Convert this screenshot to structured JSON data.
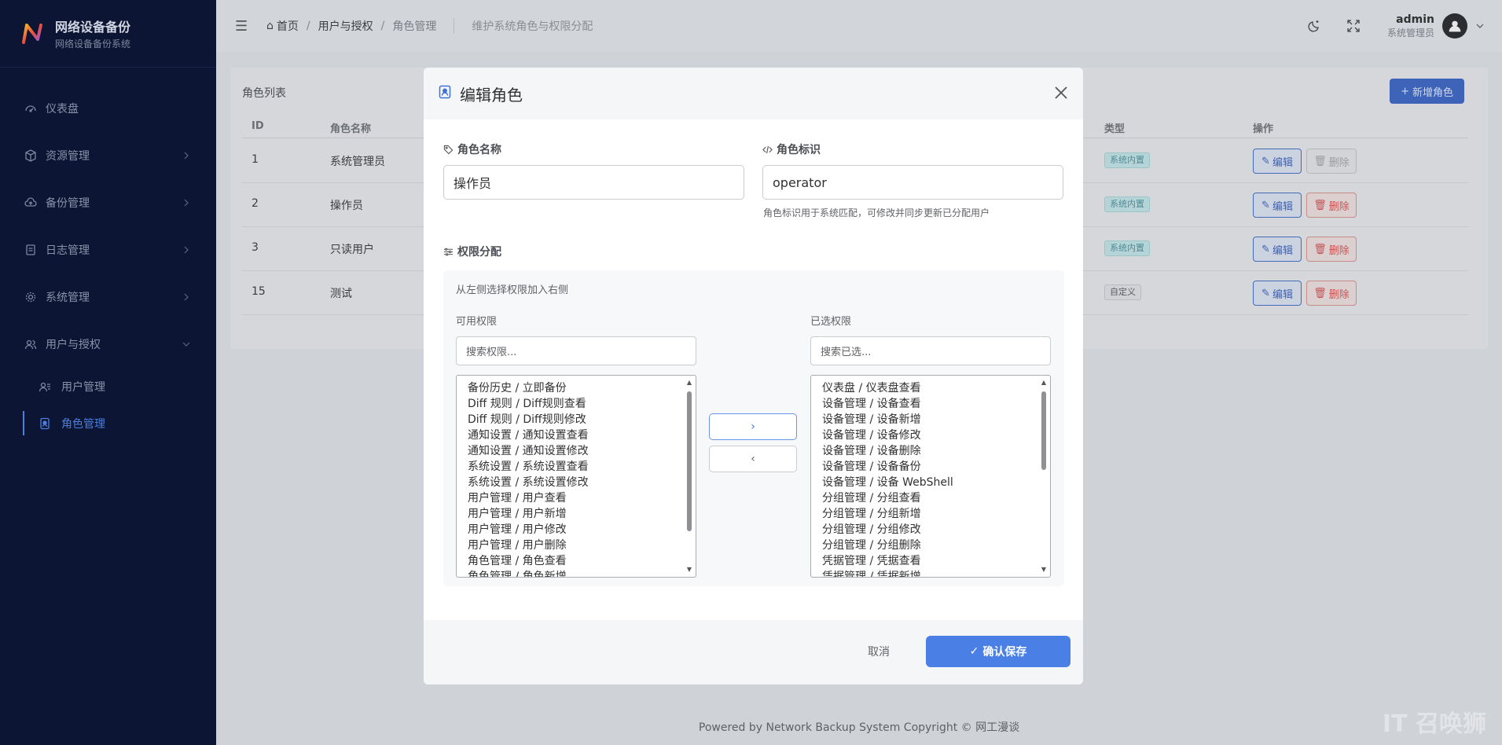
{
  "brand": {
    "title": "网络设备备份",
    "subtitle": "网络设备备份系统",
    "logo_letter": "N"
  },
  "sidebar": {
    "items": [
      {
        "label": "仪表盘",
        "icon": "dashboard-icon"
      },
      {
        "label": "资源管理",
        "icon": "cube-icon"
      },
      {
        "label": "备份管理",
        "icon": "cloud-upload-icon"
      },
      {
        "label": "日志管理",
        "icon": "document-icon"
      },
      {
        "label": "系统管理",
        "icon": "gear-icon"
      },
      {
        "label": "用户与授权",
        "icon": "users-icon"
      }
    ],
    "sub_items": [
      {
        "label": "用户管理",
        "icon": "user-manage-icon"
      },
      {
        "label": "角色管理",
        "icon": "role-badge-icon"
      }
    ]
  },
  "header": {
    "breadcrumb": {
      "home": "首页",
      "level1": "用户与授权",
      "current": "角色管理"
    },
    "description": "维护系统角色与权限分配",
    "user_name": "admin",
    "user_role": "系统管理员"
  },
  "page": {
    "card_title": "角色列表",
    "add_button": "新增角色",
    "columns": [
      "ID",
      "角色名称",
      "类型",
      "操作"
    ],
    "rows": [
      {
        "id": "1",
        "name": "系统管理员",
        "type": "系统内置",
        "type_kind": "sys",
        "edit": "编辑",
        "delete": "删除",
        "delete_disabled": true
      },
      {
        "id": "2",
        "name": "操作员",
        "type": "系统内置",
        "type_kind": "sys",
        "edit": "编辑",
        "delete": "删除",
        "delete_disabled": false
      },
      {
        "id": "3",
        "name": "只读用户",
        "type": "系统内置",
        "type_kind": "sys",
        "edit": "编辑",
        "delete": "删除",
        "delete_disabled": false
      },
      {
        "id": "15",
        "name": "测试",
        "type": "自定义",
        "type_kind": "cust",
        "edit": "编辑",
        "delete": "删除",
        "delete_disabled": false
      }
    ]
  },
  "footer": {
    "text": "Powered by Network Backup System Copyright © 网工漫谈"
  },
  "watermark": {
    "text": "IT 召唤狮"
  },
  "modal": {
    "title": "编辑角色",
    "role_name_label": "角色名称",
    "role_name_value": "操作员",
    "role_key_label": "角色标识",
    "role_key_value": "operator",
    "role_key_hint": "角色标识用于系统匹配，可修改并同步更新已分配用户",
    "perm_label": "权限分配",
    "perm_tip": "从左侧选择权限加入右侧",
    "available_label": "可用权限",
    "available_search_placeholder": "搜索权限...",
    "available": [
      "备份历史 / 立即备份",
      "Diff 规则 / Diff规则查看",
      "Diff 规则 / Diff规则修改",
      "通知设置 / 通知设置查看",
      "通知设置 / 通知设置修改",
      "系统设置 / 系统设置查看",
      "系统设置 / 系统设置修改",
      "用户管理 / 用户查看",
      "用户管理 / 用户新增",
      "用户管理 / 用户修改",
      "用户管理 / 用户删除",
      "角色管理 / 角色查看",
      "角色管理 / 角色新增"
    ],
    "selected_label": "已选权限",
    "selected_search_placeholder": "搜索已选...",
    "selected": [
      "仪表盘 / 仪表盘查看",
      "设备管理 / 设备查看",
      "设备管理 / 设备新增",
      "设备管理 / 设备修改",
      "设备管理 / 设备删除",
      "设备管理 / 设备备份",
      "设备管理 / 设备 WebShell",
      "分组管理 / 分组查看",
      "分组管理 / 分组新增",
      "分组管理 / 分组修改",
      "分组管理 / 分组删除",
      "凭据管理 / 凭据查看",
      "凭据管理 / 凭据新增"
    ],
    "move_right": "›",
    "move_left": "‹",
    "cancel": "取消",
    "confirm": "确认保存"
  },
  "colors": {
    "accent": "#4a7fe6",
    "sidebar_bg": "#0c1533",
    "danger": "#c25555"
  }
}
